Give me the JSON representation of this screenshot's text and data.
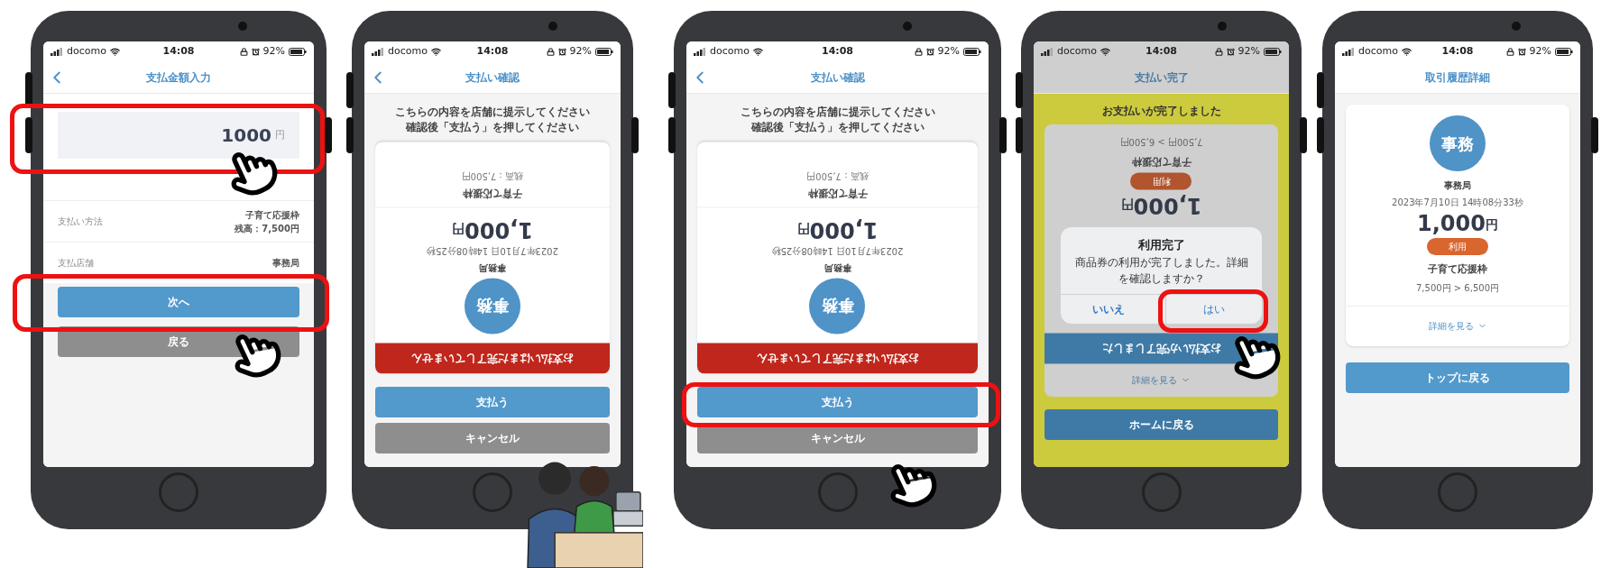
{
  "phones": [
    {
      "kind": "amount_input",
      "status": {
        "carrier": "docomo",
        "time": "14:08",
        "battery": "92%"
      },
      "header": {
        "title": "支払金額入力",
        "back": true
      },
      "amount": {
        "value": "1000",
        "unit": "円"
      },
      "rows": [
        {
          "label": "支払い方法",
          "value": "子育て応援枠",
          "sub": "残高：7,500円"
        },
        {
          "label": "支払店舗",
          "value": "事務局"
        }
      ],
      "buttons": [
        {
          "label": "次へ",
          "kind": "primary"
        },
        {
          "label": "戻る",
          "kind": "secondary"
        }
      ]
    },
    {
      "kind": "payment_confirm",
      "status": {
        "carrier": "docomo",
        "time": "14:08",
        "battery": "92%"
      },
      "header": {
        "title": "支払い確認",
        "back": true
      },
      "instructions": [
        "こちらの内容を店舗に提示してください",
        "確認後「支払う」を押してください"
      ],
      "card": {
        "banner": "お支払いはまだ完了していません",
        "avatar": "事務",
        "store": "事務局",
        "datetime": "2023年7月10日 14時08分25秒",
        "amount": "1,000",
        "unit": "円",
        "budget": "子育て応援枠",
        "balance": "残高：7,500円"
      },
      "buttons": [
        {
          "label": "支払う",
          "kind": "primary"
        },
        {
          "label": "キャンセル",
          "kind": "secondary"
        }
      ]
    },
    {
      "kind": "payment_confirm",
      "status": {
        "carrier": "docomo",
        "time": "14:08",
        "battery": "92%"
      },
      "header": {
        "title": "支払い確認",
        "back": true
      },
      "instructions": [
        "こちらの内容を店舗に提示してください",
        "確認後「支払う」を押してください"
      ],
      "card": {
        "banner": "お支払いはまだ完了していません",
        "avatar": "事務",
        "store": "事務局",
        "datetime": "2023年7月10日 14時08分25秒",
        "amount": "1,000",
        "unit": "円",
        "budget": "子育て応援枠",
        "balance": "残高：7,500円"
      },
      "buttons": [
        {
          "label": "支払う",
          "kind": "primary"
        },
        {
          "label": "キャンセル",
          "kind": "secondary"
        }
      ]
    },
    {
      "kind": "payment_complete",
      "status": {
        "carrier": "docomo",
        "time": "14:08",
        "battery": "92%"
      },
      "header": {
        "title": "支払い完了",
        "back": false
      },
      "message": "お支払いが完了しました",
      "card": {
        "banner": "お支払いが完了しました",
        "amount": "1,000",
        "unit": "円",
        "badge": "利用",
        "budget": "子育て応援枠",
        "balance": "7,500円 > 6,500円",
        "details": "詳細を見る"
      },
      "dialog": {
        "title": "利用完了",
        "message": "商品券の利用が完了しました。詳細を確認しますか？",
        "buttons": [
          {
            "label": "いいえ",
            "kind": "cancel"
          },
          {
            "label": "はい",
            "kind": "default"
          }
        ]
      },
      "buttons": [
        {
          "label": "ホームに戻る",
          "kind": "primary"
        }
      ]
    },
    {
      "kind": "history_detail",
      "status": {
        "carrier": "docomo",
        "time": "14:08",
        "battery": "92%"
      },
      "header": {
        "title": "取引履歴詳細",
        "back": false
      },
      "card": {
        "avatar": "事務",
        "store": "事務局",
        "datetime": "2023年7月10日 14時08分33秒",
        "amount": "1,000",
        "unit": "円",
        "badge": "利用",
        "budget": "子育て応援枠",
        "balance": "7,500円 > 6,500円",
        "details": "詳細を見る"
      },
      "buttons": [
        {
          "label": "トップに戻る",
          "kind": "primary"
        }
      ]
    }
  ]
}
